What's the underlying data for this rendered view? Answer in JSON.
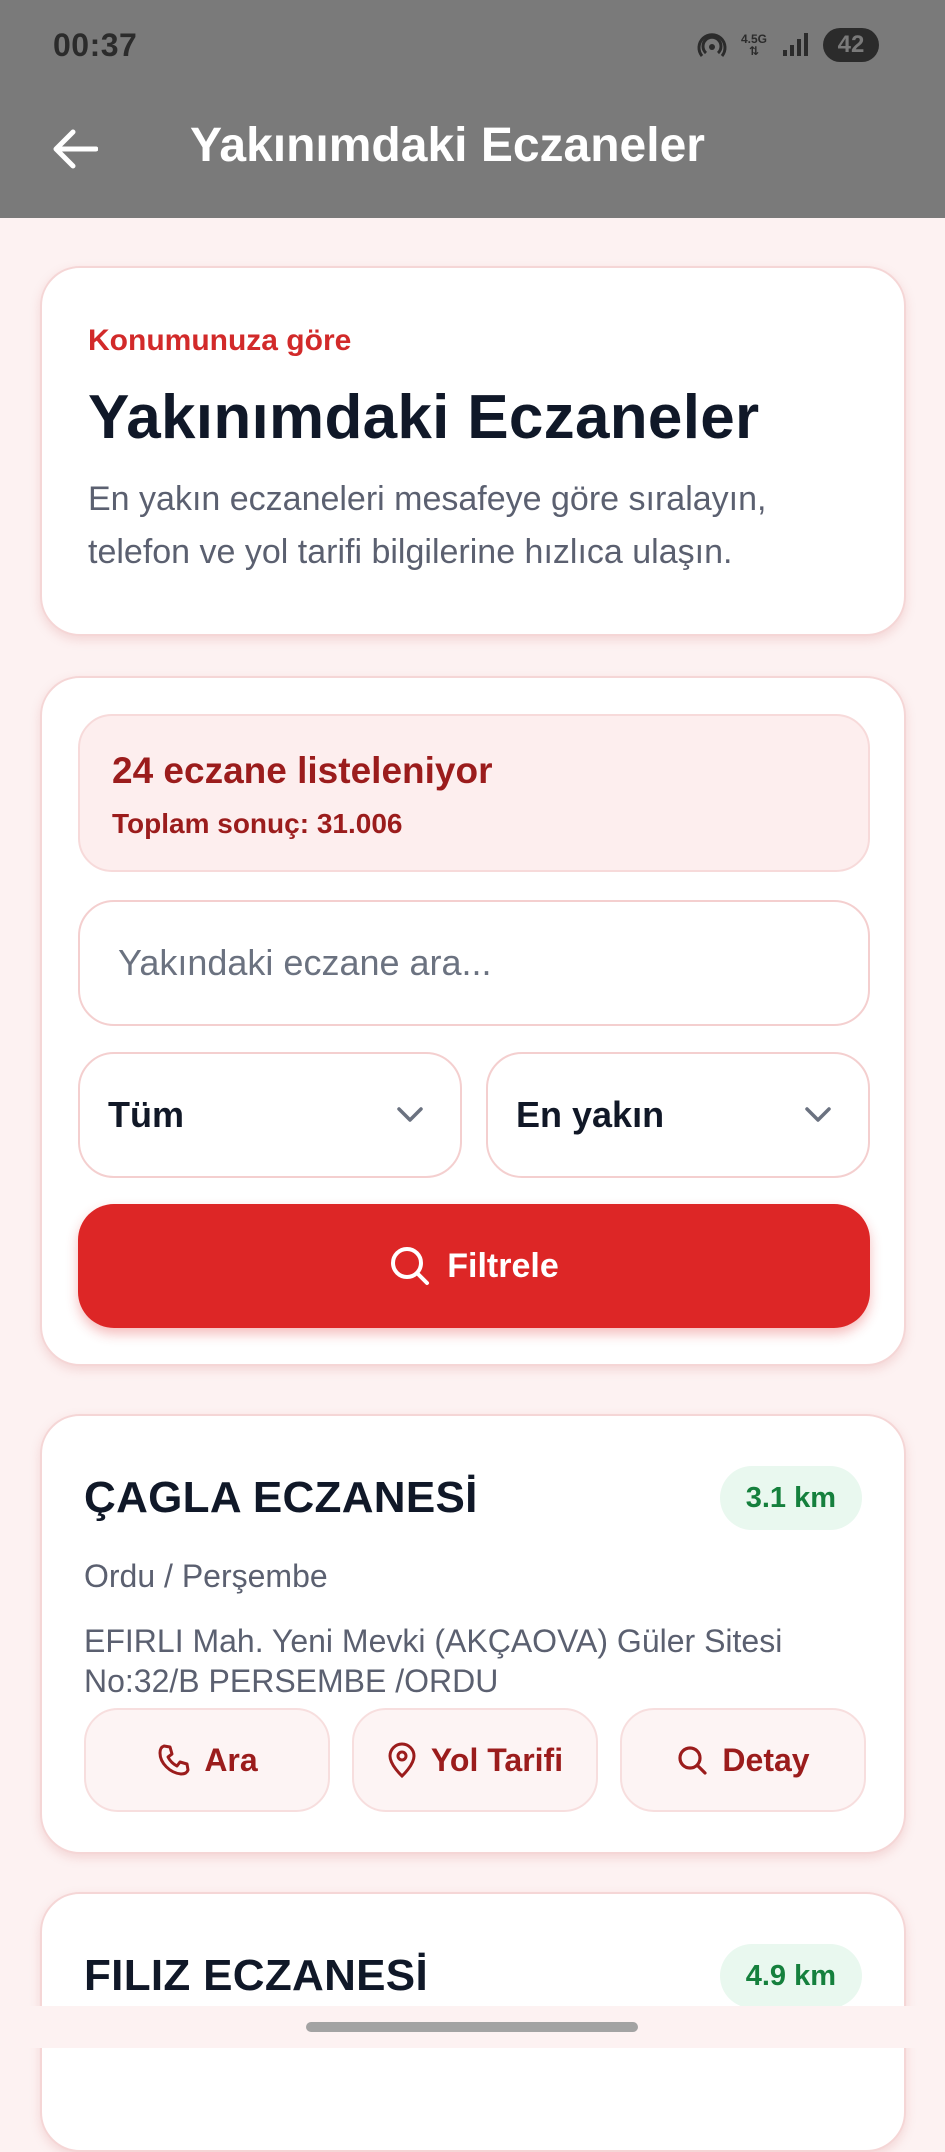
{
  "status_bar": {
    "time": "00:37",
    "network": "4.5G",
    "battery": "42"
  },
  "toolbar": {
    "title": "Yakınımdaki Eczaneler"
  },
  "hero": {
    "eyebrow": "Konumunuza göre",
    "title": "Yakınımdaki Eczaneler",
    "description": "En yakın eczaneleri mesafeye göre sıralayın, telefon ve yol tarifi bilgilerine hızlıca ulaşın."
  },
  "summary": {
    "count_text": "24 eczane listeleniyor",
    "total_text": "Toplam sonuç: 31.006"
  },
  "search": {
    "placeholder": "Yakındaki eczane ara...",
    "value": ""
  },
  "filters": {
    "type_selected": "Tüm",
    "sort_selected": "En yakın",
    "filter_button": "Filtrele"
  },
  "pharmacies": [
    {
      "name": "ÇAGLA ECZANESİ",
      "distance": "3.1 km",
      "city": "Ordu / Perşembe",
      "address": "EFIRLI Mah. Yeni Mevki (AKÇAOVA) Güler Sitesi No:32/B PERSEMBE /ORDU",
      "actions": {
        "call": "Ara",
        "directions": "Yol Tarifi",
        "detail": "Detay"
      }
    },
    {
      "name": "FILIZ ECZANESİ",
      "distance": "4.9 km"
    }
  ],
  "colors": {
    "accent": "#dd2626",
    "appbar": "#7a7a7a",
    "distance_green": "#15803d"
  }
}
